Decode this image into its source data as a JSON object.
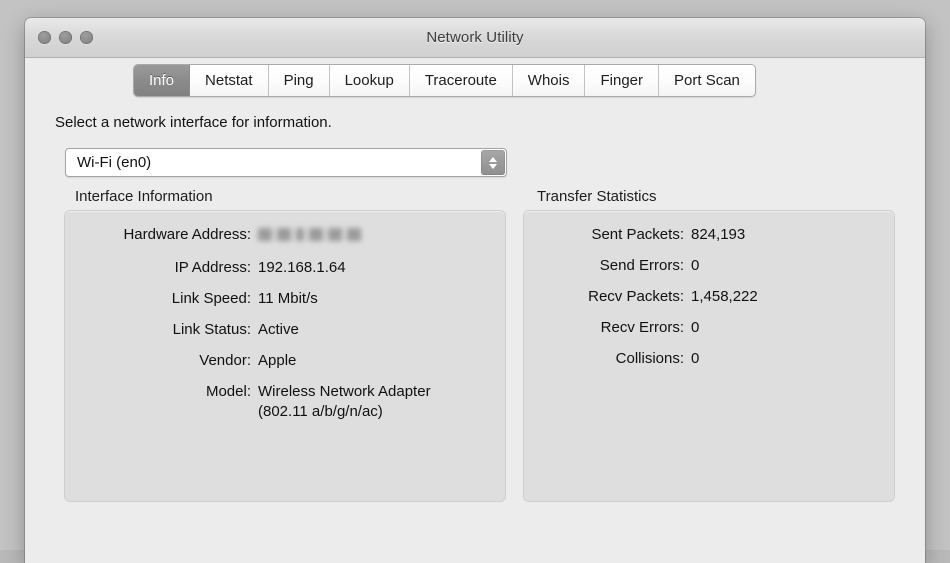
{
  "window": {
    "title": "Network Utility",
    "traffic_lights": [
      "close-button",
      "minimize-button",
      "zoom-button"
    ]
  },
  "tabs": [
    {
      "label": "Info",
      "selected": true
    },
    {
      "label": "Netstat",
      "selected": false
    },
    {
      "label": "Ping",
      "selected": false
    },
    {
      "label": "Lookup",
      "selected": false
    },
    {
      "label": "Traceroute",
      "selected": false
    },
    {
      "label": "Whois",
      "selected": false
    },
    {
      "label": "Finger",
      "selected": false
    },
    {
      "label": "Port Scan",
      "selected": false
    }
  ],
  "main": {
    "instruction": "Select a network interface for information.",
    "interface_select": {
      "value": "Wi-Fi (en0)",
      "options": [
        "Wi-Fi (en0)"
      ]
    },
    "interface_information": {
      "header": "Interface Information",
      "rows": [
        {
          "label": "Hardware Address:",
          "value": "",
          "redacted": true
        },
        {
          "label": "IP Address:",
          "value": "192.168.1.64",
          "redacted": false
        },
        {
          "label": "Link Speed:",
          "value": "11 Mbit/s",
          "redacted": false
        },
        {
          "label": "Link Status:",
          "value": "Active",
          "redacted": false
        },
        {
          "label": "Vendor:",
          "value": "Apple",
          "redacted": false
        },
        {
          "label": "Model:",
          "value": "Wireless Network Adapter (802.11 a/b/g/n/ac)",
          "redacted": false
        }
      ]
    },
    "transfer_statistics": {
      "header": "Transfer Statistics",
      "rows": [
        {
          "label": "Sent Packets:",
          "value": "824,193"
        },
        {
          "label": "Send Errors:",
          "value": "0"
        },
        {
          "label": "Recv Packets:",
          "value": "1,458,222"
        },
        {
          "label": "Recv Errors:",
          "value": "0"
        },
        {
          "label": "Collisions:",
          "value": "0"
        }
      ]
    }
  },
  "colors": {
    "window_chrome": "#ececec",
    "panel_fill": "#dedede",
    "selected_tab": "#8b8b8b",
    "text": "#111111"
  }
}
